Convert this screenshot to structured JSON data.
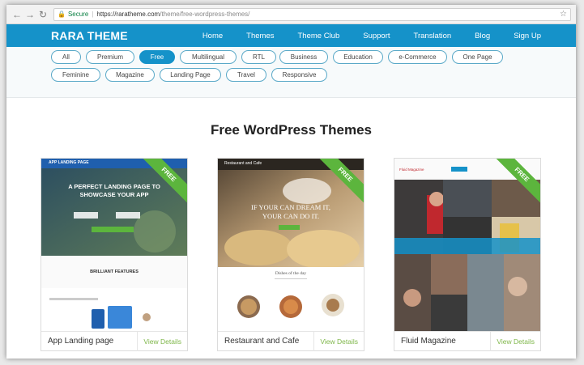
{
  "browser": {
    "secure_label": "Secure",
    "url_host": "https://raratheme.com",
    "url_path": "/theme/free-wordpress-themes/"
  },
  "site": {
    "logo": "RARA THEME",
    "menu": [
      "Home",
      "Themes",
      "Theme Club",
      "Support",
      "Translation",
      "Blog",
      "Sign Up"
    ]
  },
  "filters": {
    "row1": [
      "All",
      "Premium",
      "Free",
      "Multilingual",
      "RTL",
      "Business",
      "Education",
      "e-Commerce",
      "One Page"
    ],
    "row2": [
      "Feminine",
      "Magazine",
      "Landing Page",
      "Travel",
      "Responsive"
    ],
    "active": "Free"
  },
  "heading": "Free WordPress Themes",
  "cards": [
    {
      "title": "App Landing page",
      "view": "View Details",
      "badge": "FREE",
      "preview": {
        "brand": "APP LANDING PAGE",
        "headline1": "A PERFECT LANDING PAGE TO",
        "headline2": "SHOWCASE YOUR APP",
        "features": "BRILLIANT FEATURES"
      }
    },
    {
      "title": "Restaurant and Cafe",
      "view": "View Details",
      "badge": "FREE",
      "preview": {
        "brand": "Restaurant and Cafe",
        "headline1": "IF YOUR CAN DREAM IT,",
        "headline2": "YOUR CAN DO IT.",
        "dishes": "Dishes of the day"
      }
    },
    {
      "title": "Fluid Magazine",
      "view": "View Details",
      "badge": "FREE",
      "preview": {
        "brand": "Fluid Magazine"
      }
    }
  ]
}
